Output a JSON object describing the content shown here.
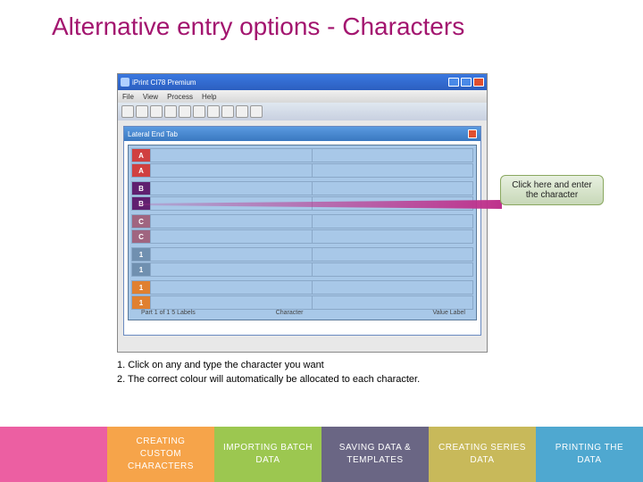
{
  "title": "Alternative entry options - Characters",
  "app": {
    "window_title": "iPrint CI78 Premium",
    "menu": [
      "File",
      "View",
      "Process",
      "Help"
    ],
    "panel_title": "Lateral End Tab",
    "rows": [
      {
        "label": "A"
      },
      {
        "label": "B"
      },
      {
        "label": "C"
      },
      {
        "label": "1"
      },
      {
        "label": "1"
      }
    ],
    "footer": {
      "left": "Part 1 of 1  5 Labels",
      "mid": "Character",
      "right": "Value Label"
    }
  },
  "callout": "Click here and enter the character",
  "instructions": {
    "i1": "1.  Click on any and type the character you want",
    "i2": "2.  The correct colour will automatically be allocated to each character."
  },
  "nav": {
    "n1": "CREATING CUSTOM CHARACTERS",
    "n2": "IMPORTING BATCH DATA",
    "n3": "SAVING DATA & TEMPLATES",
    "n4": "CREATING SERIES DATA",
    "n5": "PRINTING THE DATA"
  }
}
